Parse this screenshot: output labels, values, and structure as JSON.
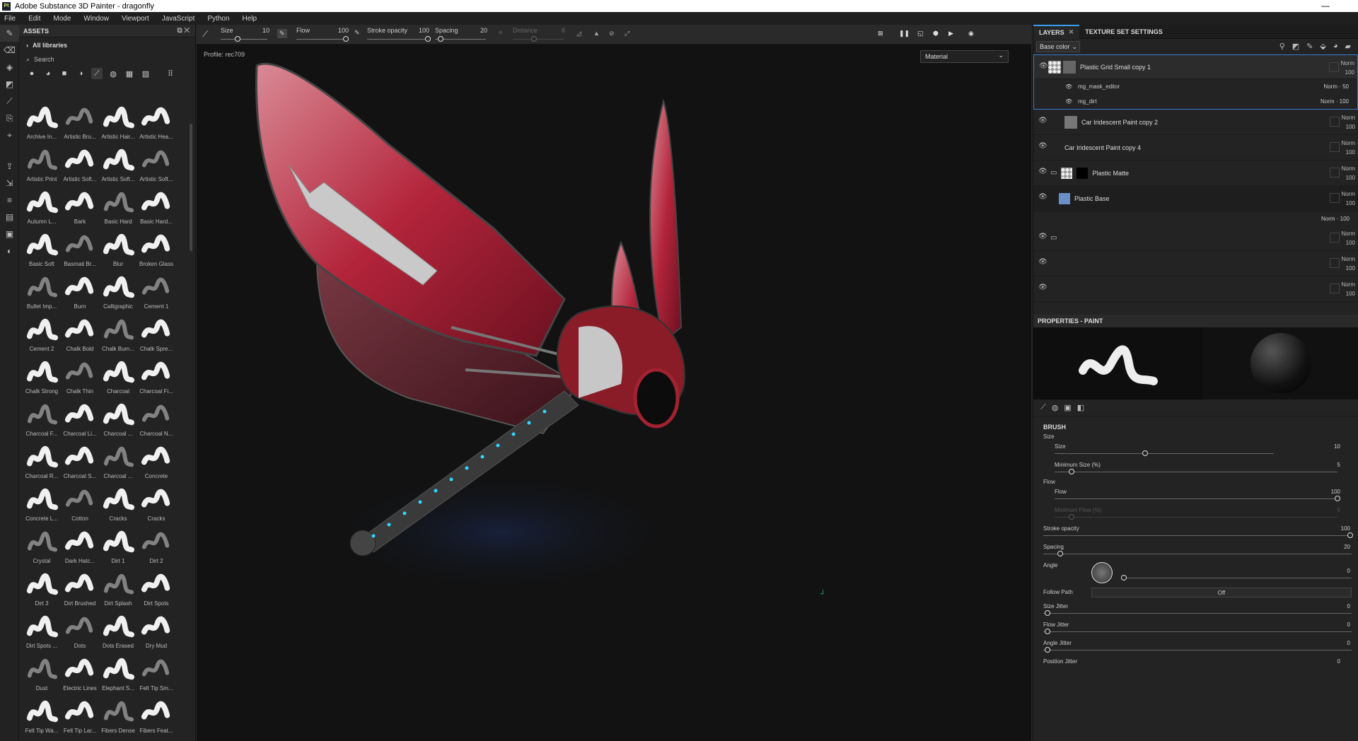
{
  "window": {
    "title": "Adobe Substance 3D Painter - dragonfly",
    "app_icon": "Pt"
  },
  "menu": [
    "File",
    "Edit",
    "Mode",
    "Window",
    "Viewport",
    "JavaScript",
    "Python",
    "Help"
  ],
  "assets": {
    "title": "ASSETS",
    "library": "All libraries",
    "search_placeholder": "Search",
    "brushes": [
      "Archive In...",
      "Artistic Bru...",
      "Artistic Hair...",
      "Artistic Hea...",
      "Artistic Print",
      "Artistic Soft...",
      "Artistic Soft...",
      "Artistic Soft...",
      "Autumn L...",
      "Bark",
      "Basic Hard",
      "Basic Hard...",
      "Basic Soft",
      "Basmati Br...",
      "Blur",
      "Broken Glass",
      "Bullet Imp...",
      "Burn",
      "Calligraphic",
      "Cement 1",
      "Cement 2",
      "Chalk Bold",
      "Chalk Bum...",
      "Chalk Spre...",
      "Chalk Strong",
      "Chalk Thin",
      "Charcoal",
      "Charcoal Fi...",
      "Charcoal F...",
      "Charcoal Li...",
      "Charcoal ...",
      "Charcoal N...",
      "Charcoal R...",
      "Charcoal S...",
      "Charcoal ...",
      "Concrete",
      "Concrete L...",
      "Cotton",
      "Cracks",
      "Cracks",
      "Crystal",
      "Dark Hatc...",
      "Dirt 1",
      "Dirt 2",
      "Dirt 3",
      "Dirt Brushed",
      "Dirt Splash",
      "Dirt Spots",
      "Dirt Spots ...",
      "Dots",
      "Dots Erased",
      "Dry Mud",
      "Dust",
      "Electric Lines",
      "Elephant S...",
      "Felt Tip Sm...",
      "Felt Tip Wa...",
      "Felt Tip Lar...",
      "Fibers Dense",
      "Fibers Feat..."
    ]
  },
  "toolbar": {
    "size_label": "Size",
    "size_value": "10",
    "flow_label": "Flow",
    "flow_value": "100",
    "stroke_label": "Stroke opacity",
    "stroke_value": "100",
    "spacing_label": "Spacing",
    "spacing_value": "20",
    "distance_label": "Distance",
    "distance_value": "8"
  },
  "viewport": {
    "profile": "Profile: rec709",
    "mode": "Material"
  },
  "layers": {
    "tab_layers": "LAYERS",
    "tab_texture": "TEXTURE SET SETTINGS",
    "channel": "Base color",
    "items": [
      {
        "name": "Plastic Grid Small copy 1",
        "blend": "Norm",
        "opacity": "100"
      },
      {
        "name": "Car Iridescent Paint copy 2",
        "blend": "Norm",
        "opacity": "100"
      },
      {
        "name": "Car Iridescent Paint copy 4",
        "blend": "Norm",
        "opacity": "100"
      },
      {
        "name": "Plastic Matte",
        "blend": "Norm",
        "opacity": "100"
      },
      {
        "name": "Plastic Base",
        "blend": "Norm",
        "opacity": "100"
      },
      {
        "name": "",
        "blend": "Norm",
        "opacity": "100"
      },
      {
        "name": "",
        "blend": "Norm",
        "opacity": "100"
      },
      {
        "name": "",
        "blend": "Norm",
        "opacity": "100"
      }
    ],
    "sub": [
      {
        "name": "mg_mask_editor",
        "blend": "Norm",
        "opacity": "50"
      },
      {
        "name": "mg_dirt",
        "blend": "Norm",
        "opacity": "100"
      }
    ],
    "extra_row": {
      "blend": "Norm",
      "opacity": "100"
    }
  },
  "properties": {
    "title": "PROPERTIES - PAINT",
    "section": "BRUSH",
    "size_group": "Size",
    "size": {
      "label": "Size",
      "value": "10"
    },
    "min_size": {
      "label": "Minimum Size (%)",
      "value": "5"
    },
    "flow_group": "Flow",
    "flow": {
      "label": "Flow",
      "value": "100"
    },
    "min_flow": {
      "label": "Minimum Flow (%)",
      "value": "5"
    },
    "stroke_opacity": {
      "label": "Stroke opacity",
      "value": "100"
    },
    "spacing": {
      "label": "Spacing",
      "value": "20"
    },
    "angle": {
      "label": "Angle",
      "value": "0"
    },
    "follow_path": {
      "label": "Follow Path",
      "value": "Off"
    },
    "size_jitter": {
      "label": "Size Jitter",
      "value": "0"
    },
    "flow_jitter": {
      "label": "Flow Jitter",
      "value": "0"
    },
    "angle_jitter": {
      "label": "Angle Jitter",
      "value": "0"
    },
    "position_jitter": {
      "label": "Position Jitter",
      "value": "0"
    }
  },
  "colors": {
    "accent": "#3b9cf0",
    "wing_red": "#b3243a",
    "glow": "#2fd6ff"
  }
}
